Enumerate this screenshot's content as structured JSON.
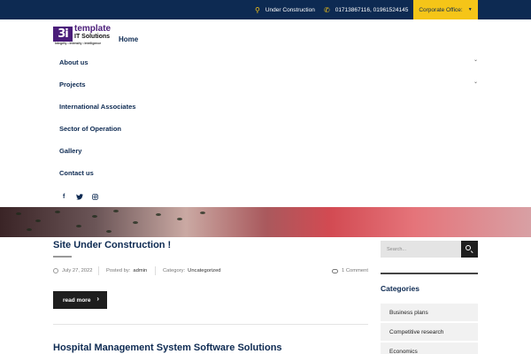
{
  "topbar": {
    "location_icon": "map-pin-icon",
    "location_text": "Under Construction",
    "phone_icon": "phone-icon",
    "phone_text": "01713867116, 01961524145",
    "office_label": "Corporate Office:",
    "colors": {
      "bar": "#0d2a52",
      "accent": "#f5c518"
    }
  },
  "header": {
    "logo": {
      "mark": "3i",
      "line1": "template",
      "line2": "IT Solutions",
      "tagline": "Integrity • Intensity • Intelligence"
    },
    "home_label": "Home"
  },
  "nav": {
    "items": [
      {
        "label": "About us",
        "has_submenu": true
      },
      {
        "label": "Projects",
        "has_submenu": true
      },
      {
        "label": "International Associates",
        "has_submenu": false
      },
      {
        "label": "Sector of Operation",
        "has_submenu": false
      },
      {
        "label": "Gallery",
        "has_submenu": false
      },
      {
        "label": "Contact us",
        "has_submenu": false
      }
    ],
    "social_icons": [
      "facebook-icon",
      "twitter-icon",
      "instagram-icon"
    ]
  },
  "posts": [
    {
      "title": "Site Under Construction !",
      "date": "July 27, 2022",
      "posted_by_label": "Posted by:",
      "author": "admin",
      "category_label": "Category:",
      "category": "Uncategorized",
      "comments": "1 Comment",
      "read_more": "read more"
    },
    {
      "title": "Hospital Management System Software Solutions"
    }
  ],
  "sidebar": {
    "search_placeholder": "Search...",
    "categories_heading": "Categories",
    "categories": [
      "Business plans",
      "Competitive research",
      "Economics"
    ]
  }
}
